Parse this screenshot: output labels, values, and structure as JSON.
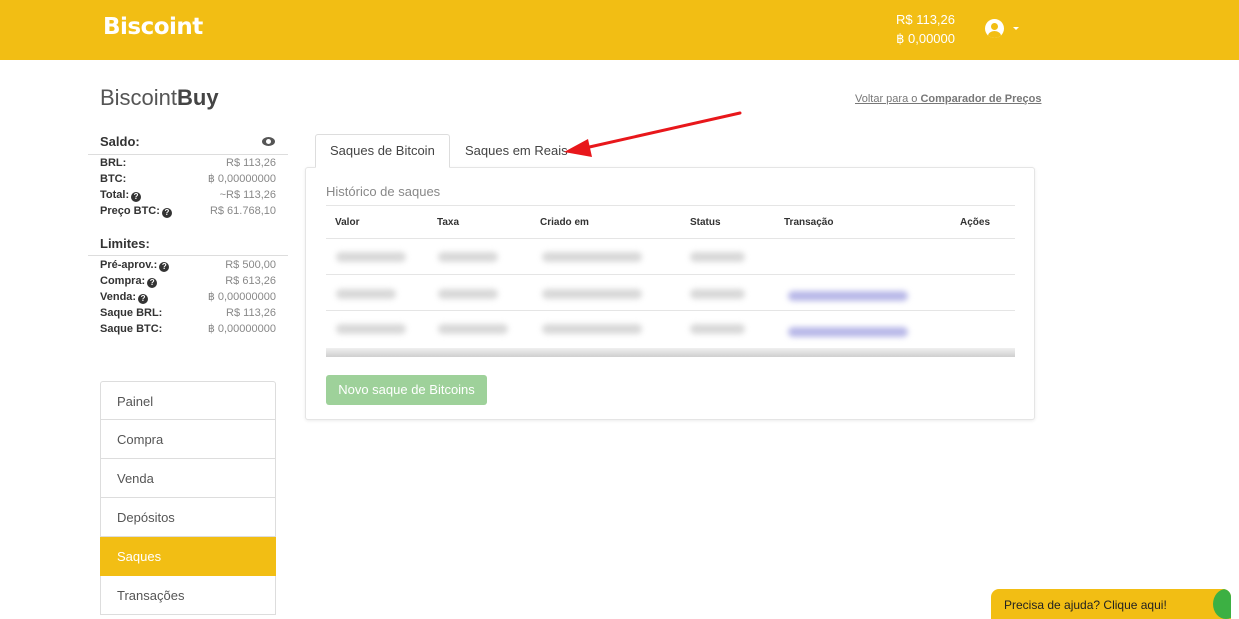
{
  "header": {
    "logo": "Biscoint",
    "balance_brl": "R$ 113,26",
    "balance_btc": "฿ 0,00000"
  },
  "brand": {
    "prefix": "Biscoint",
    "suffix": "Buy"
  },
  "back_link": {
    "prefix": "Voltar para o ",
    "bold": "Comparador de Preços"
  },
  "saldo": {
    "title": "Saldo:",
    "rows": [
      {
        "label": "BRL:",
        "value": "R$ 113,26",
        "help": false
      },
      {
        "label": "BTC:",
        "value": "฿ 0,00000000",
        "help": false
      },
      {
        "label": "Total:",
        "value": "~R$ 113,26",
        "help": true
      },
      {
        "label": "Preço BTC:",
        "value": "R$ 61.768,10",
        "help": true
      }
    ]
  },
  "limites": {
    "title": "Limites:",
    "rows": [
      {
        "label": "Pré-aprov.:",
        "value": "R$ 500,00",
        "help": true
      },
      {
        "label": "Compra:",
        "value": "R$ 613,26",
        "help": true
      },
      {
        "label": "Venda:",
        "value": "฿ 0,00000000",
        "help": true
      },
      {
        "label": "Saque BRL:",
        "value": "R$ 113,26",
        "help": false
      },
      {
        "label": "Saque BTC:",
        "value": "฿ 0,00000000",
        "help": false
      }
    ]
  },
  "nav": [
    {
      "label": "Painel",
      "active": false
    },
    {
      "label": "Compra",
      "active": false
    },
    {
      "label": "Venda",
      "active": false
    },
    {
      "label": "Depósitos",
      "active": false
    },
    {
      "label": "Saques",
      "active": true
    },
    {
      "label": "Transações",
      "active": false
    }
  ],
  "tabs": [
    {
      "label": "Saques de Bitcoin",
      "active": true
    },
    {
      "label": "Saques em Reais",
      "active": false
    }
  ],
  "panel": {
    "heading": "Histórico de saques",
    "columns": [
      "Valor",
      "Taxa",
      "Criado em",
      "Status",
      "Transação",
      "Ações"
    ],
    "new_button": "Novo saque de Bitcoins"
  },
  "help_widget": "Precisa de ajuda? Clique aqui!",
  "colors": {
    "brand": "#f2be14",
    "button_disabled": "#9ed19a",
    "annotation_arrow": "#e8171b"
  },
  "icons": [
    "user-circle-icon",
    "chevron-down-icon",
    "eye-icon",
    "question-circle-icon"
  ]
}
